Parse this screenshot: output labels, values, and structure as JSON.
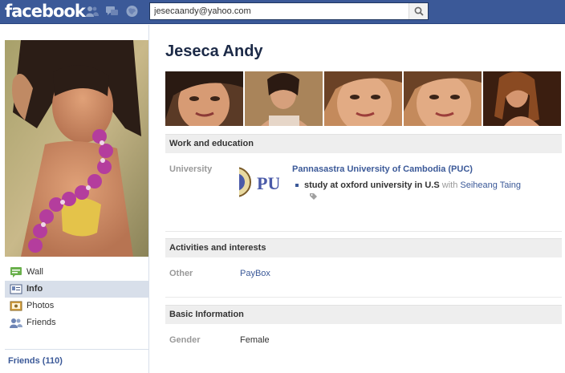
{
  "topbar": {
    "logo": "facebook",
    "icons": [
      "friend-requests-icon",
      "messages-icon",
      "notifications-icon",
      "search-icon"
    ],
    "search_value": "jesecaandy@yahoo.com"
  },
  "profile": {
    "name": "Jeseca Andy",
    "photo_count": 5
  },
  "left_nav": {
    "items": [
      {
        "label": "Wall",
        "icon": "wall-icon",
        "active": false
      },
      {
        "label": "Info",
        "icon": "info-icon",
        "active": true
      },
      {
        "label": "Photos",
        "icon": "photos-icon",
        "active": false
      },
      {
        "label": "Friends",
        "icon": "friends-icon",
        "active": false
      }
    ],
    "friends_count": "Friends (110)"
  },
  "work_education": {
    "heading": "Work and education",
    "label": "University",
    "logo_text": "PU",
    "school": "Pannasastra University of Cambodia (PUC)",
    "detail": "study at oxford university in U.S",
    "with_text": "with",
    "with_person": "Seiheang Taing"
  },
  "activities": {
    "heading": "Activities and interests",
    "label": "Other",
    "value": "PayBox"
  },
  "basic_info": {
    "heading": "Basic Information",
    "label": "Gender",
    "value": "Female"
  },
  "colors": {
    "brand_blue": "#3b5998",
    "nav_active": "#d8dfea",
    "section_bg": "#eeeeee",
    "heading_text": "#1c2a47"
  }
}
